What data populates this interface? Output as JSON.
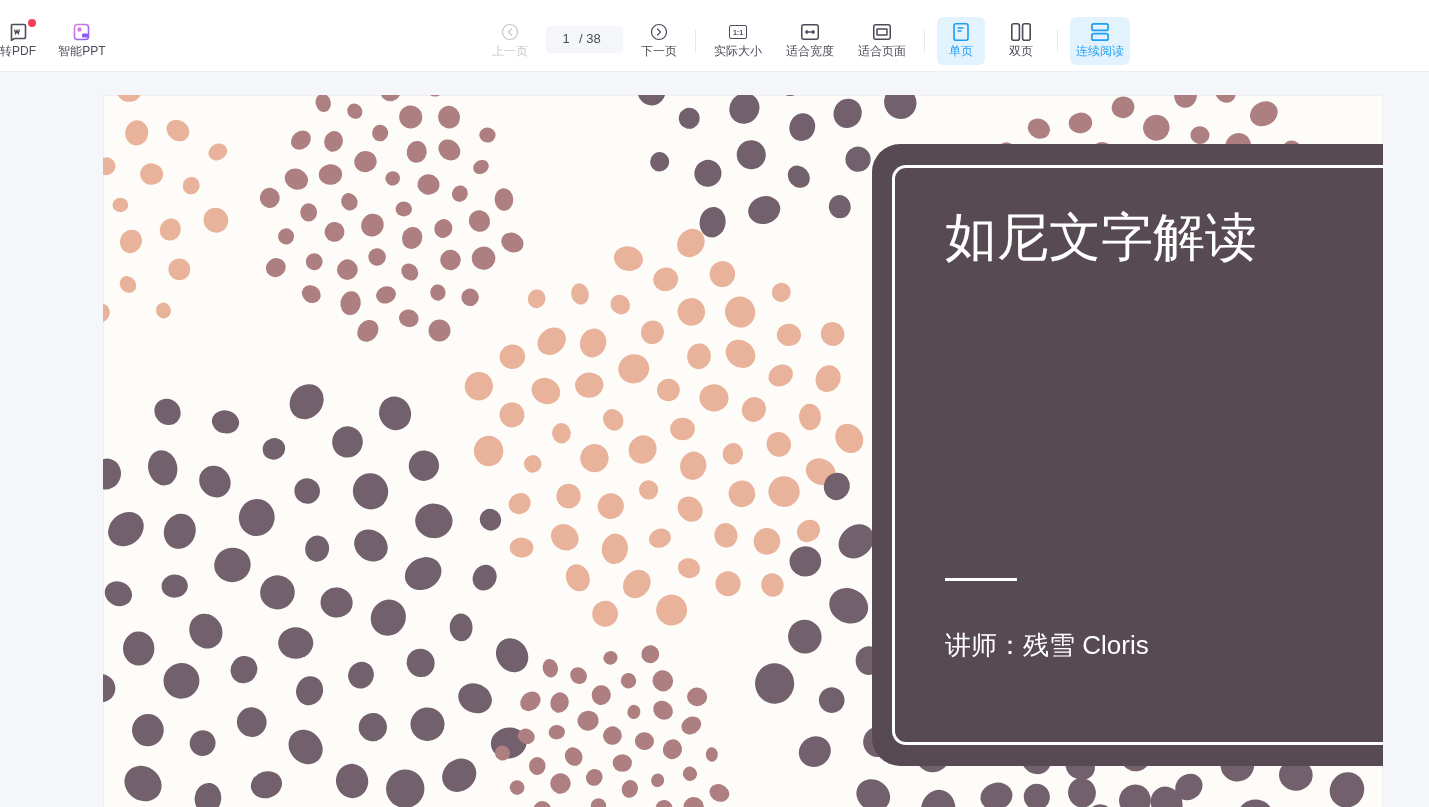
{
  "toolbar": {
    "tools": [
      {
        "kind": "pdf",
        "label": "转PDF",
        "badge": true
      },
      {
        "kind": "ppt",
        "label": "智能PPT",
        "badge": false
      }
    ],
    "navigation": {
      "prev": {
        "label": "上一页",
        "disabled": true
      },
      "page_field": {
        "value": "1",
        "total": "/ 38"
      },
      "next": {
        "label": "下一页",
        "disabled": false
      }
    },
    "zoom": [
      {
        "kind": "actual",
        "label": "实际大小",
        "icon_text": "1:1"
      },
      {
        "kind": "width",
        "label": "适合宽度"
      },
      {
        "kind": "page",
        "label": "适合页面"
      }
    ],
    "layout": [
      {
        "kind": "single",
        "label": "单页",
        "selected": true
      },
      {
        "kind": "double",
        "label": "双页",
        "selected": false
      }
    ],
    "continuous": {
      "label": "连续阅读",
      "on": true
    }
  },
  "slide": {
    "title": "如尼文字解读",
    "subtitle": "讲师：残雪 Cloris"
  }
}
